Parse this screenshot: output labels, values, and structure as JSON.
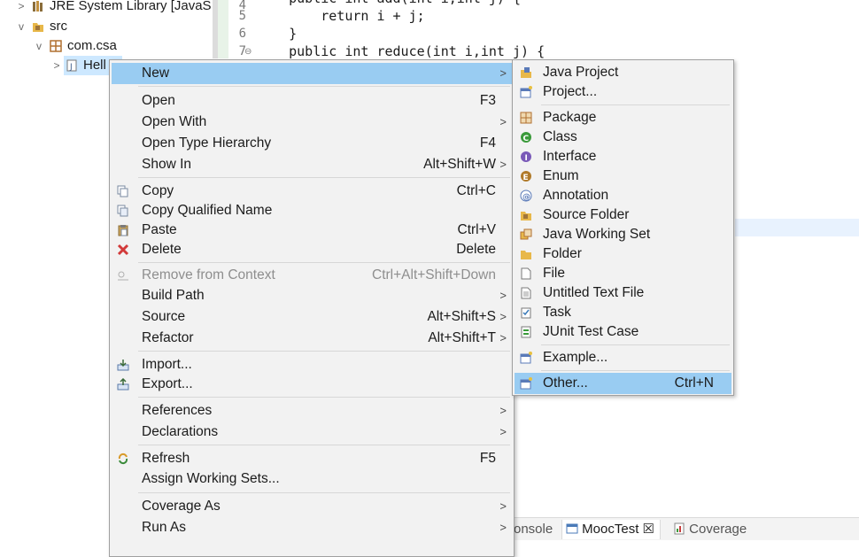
{
  "tree": {
    "items": [
      {
        "label": "JRE System Library [JavaS",
        "twisty": ">"
      },
      {
        "label": "src",
        "twisty": "v"
      },
      {
        "label": "com.csa",
        "twisty": "v"
      },
      {
        "label": "Hell",
        "twisty": ">"
      }
    ]
  },
  "editor": {
    "lines": [
      {
        "num": "4",
        "text": "    public int add(int i,int j) {"
      },
      {
        "num": "5",
        "text": "        return i + j;"
      },
      {
        "num": "6",
        "text": "    }"
      },
      {
        "num": "7",
        "text": "    public int reduce(int i,int j) {"
      }
    ]
  },
  "bottom_tabs": {
    "console": "onsole",
    "mooctest": "MoocTest",
    "mooctest_close": "☒",
    "coverage": "Coverage"
  },
  "context_menu": {
    "new": {
      "label": "New",
      "arrow": ">"
    },
    "open": {
      "label": "Open",
      "accel": "F3"
    },
    "open_with": {
      "label": "Open With",
      "arrow": ">"
    },
    "open_type_hierarchy": {
      "label": "Open Type Hierarchy",
      "accel": "F4"
    },
    "show_in": {
      "label": "Show In",
      "accel": "Alt+Shift+W",
      "arrow": ">"
    },
    "copy": {
      "label": "Copy",
      "accel": "Ctrl+C"
    },
    "copy_qualified_name": {
      "label": "Copy Qualified Name"
    },
    "paste": {
      "label": "Paste",
      "accel": "Ctrl+V"
    },
    "delete": {
      "label": "Delete",
      "accel": "Delete"
    },
    "remove_from_context": {
      "label": "Remove from Context",
      "accel": "Ctrl+Alt+Shift+Down"
    },
    "build_path": {
      "label": "Build Path",
      "arrow": ">"
    },
    "source": {
      "label": "Source",
      "accel": "Alt+Shift+S",
      "arrow": ">"
    },
    "refactor": {
      "label": "Refactor",
      "accel": "Alt+Shift+T",
      "arrow": ">"
    },
    "import": {
      "label": "Import..."
    },
    "export": {
      "label": "Export..."
    },
    "references": {
      "label": "References",
      "arrow": ">"
    },
    "declarations": {
      "label": "Declarations",
      "arrow": ">"
    },
    "refresh": {
      "label": "Refresh",
      "accel": "F5"
    },
    "assign_working_sets": {
      "label": "Assign Working Sets..."
    },
    "coverage_as": {
      "label": "Coverage As",
      "arrow": ">"
    },
    "run_as": {
      "label": "Run As",
      "arrow": ">"
    }
  },
  "new_submenu": {
    "java_project": "Java Project",
    "project": "Project...",
    "package": "Package",
    "class": "Class",
    "interface": "Interface",
    "enum": "Enum",
    "annotation": "Annotation",
    "source_folder": "Source Folder",
    "java_working_set": "Java Working Set",
    "folder": "Folder",
    "file": "File",
    "untitled_text_file": "Untitled Text File",
    "task": "Task",
    "junit_test_case": "JUnit Test Case",
    "example": "Example...",
    "other": {
      "label": "Other...",
      "accel": "Ctrl+N"
    }
  },
  "colors": {
    "highlight": "#99ccf2",
    "keyword": "#7f0055",
    "menu_bg": "#f2f2f2"
  }
}
